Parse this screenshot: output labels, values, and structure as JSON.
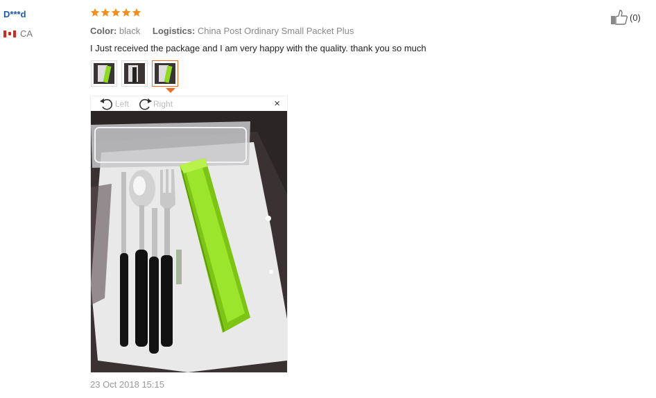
{
  "reviewer": {
    "name": "D***d",
    "country": "CA"
  },
  "rating": {
    "stars": 5,
    "max": 5,
    "color": "#f38f1f"
  },
  "meta": {
    "color_label": "Color:",
    "color_value": "black",
    "logistics_label": "Logistics:",
    "logistics_value": "China Post Ordinary Small Packet Plus"
  },
  "review": {
    "text": "I Just received the package and I am very happy with the quality. thank you so much",
    "date": "23 Oct 2018 15:15"
  },
  "thumbnails": {
    "count": 3,
    "active_index": 2
  },
  "viewer": {
    "rotate_left_label": "Left",
    "rotate_right_label": "Right",
    "close_symbol": "×"
  },
  "helpful": {
    "icon": "thumbs-up-icon",
    "count": "(0)"
  },
  "colors": {
    "accent": "#f36c21",
    "name": "#1c5aa6",
    "case_green": "#8edb1e"
  }
}
